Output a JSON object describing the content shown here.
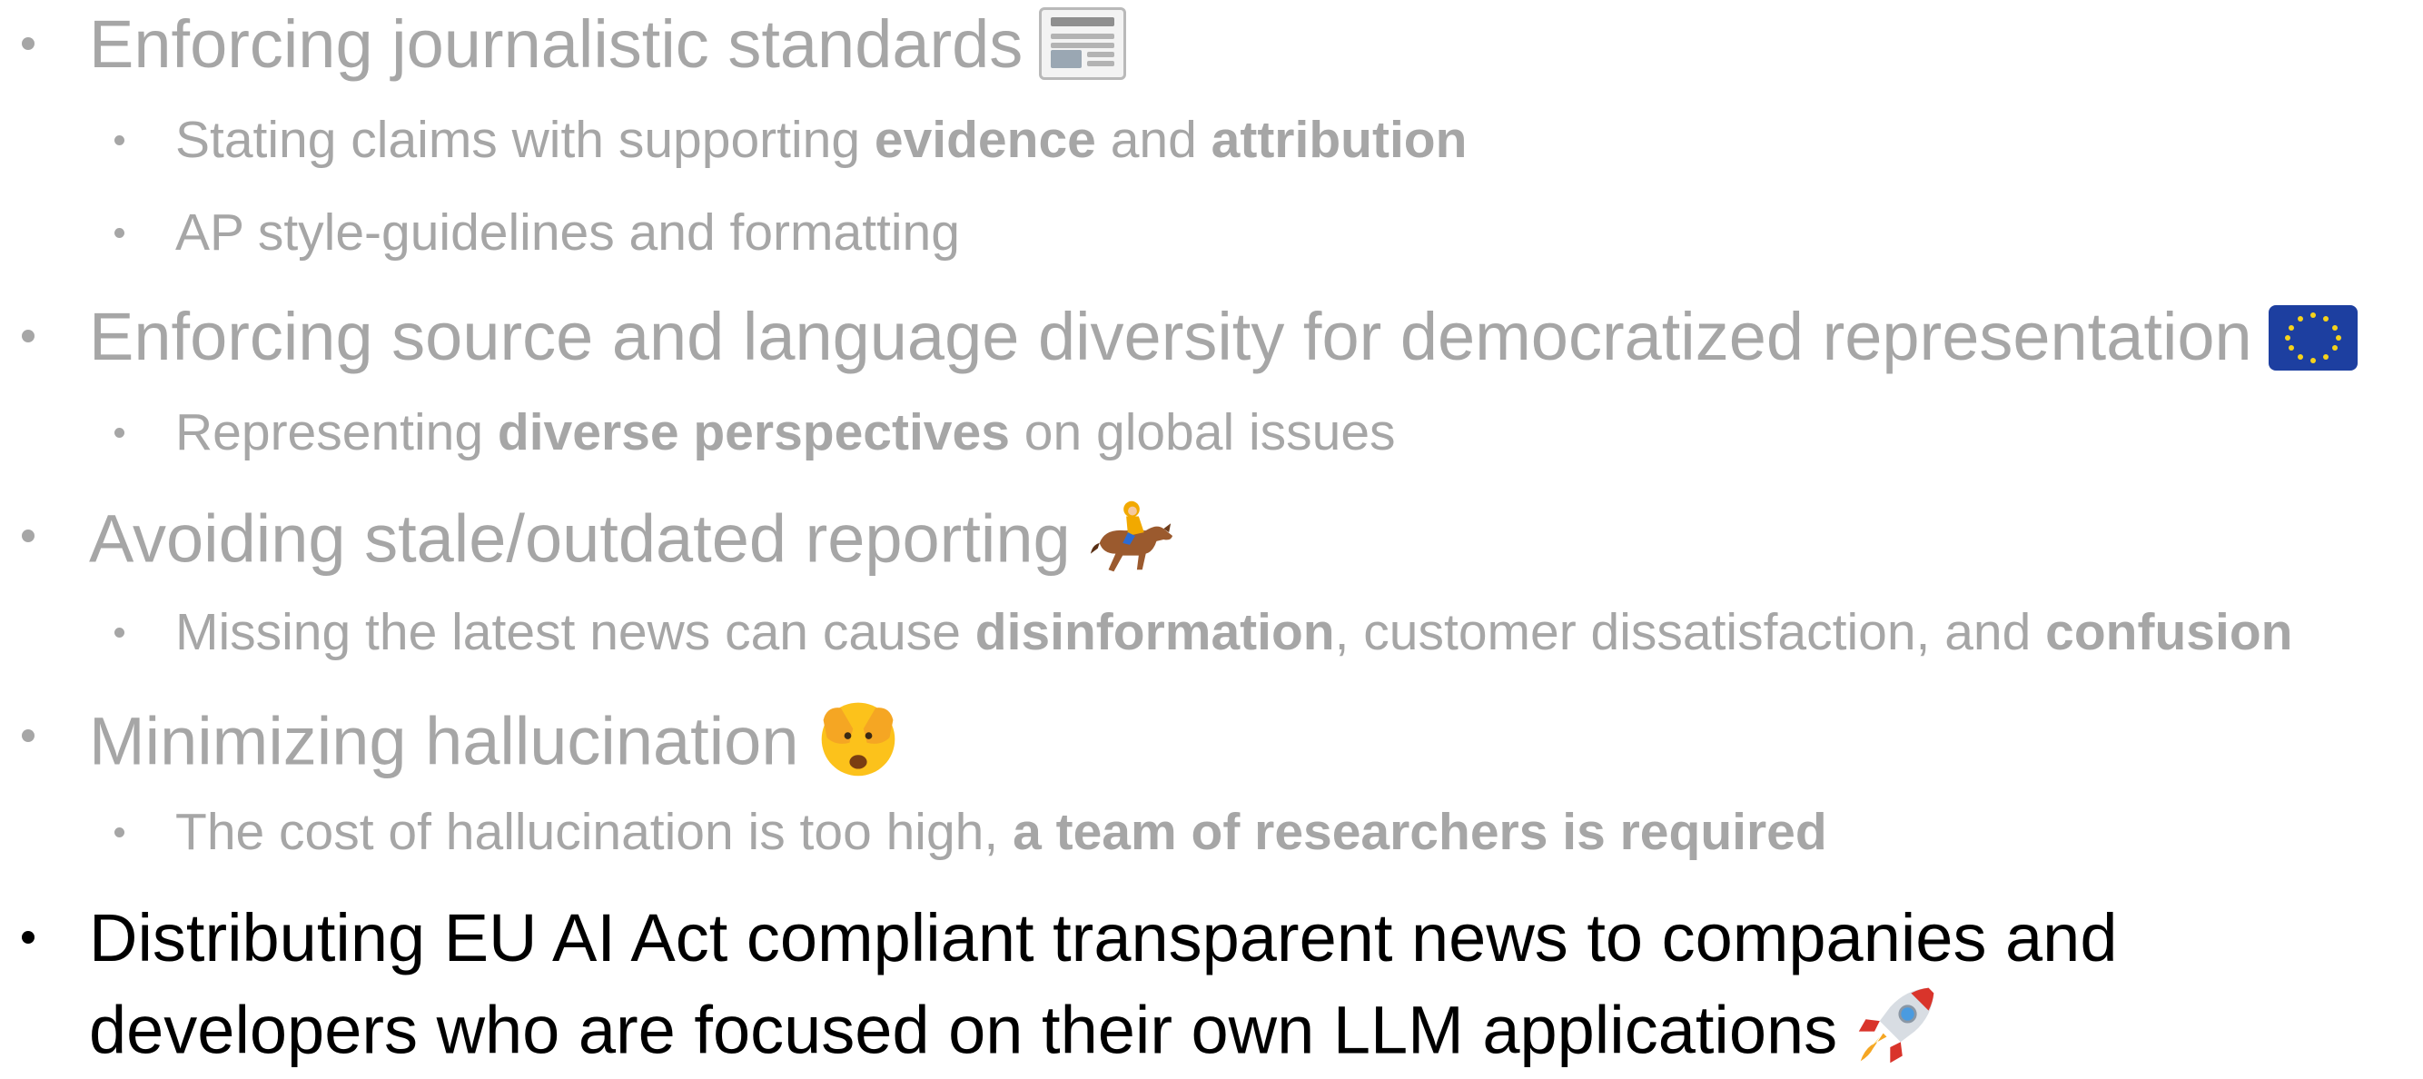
{
  "bullets": [
    {
      "level": 1,
      "style": "dim",
      "text": "Enforcing journalistic standards",
      "emoji": "newspaper-icon"
    },
    {
      "level": 2,
      "style": "dim",
      "parts": [
        {
          "t": "Stating claims with supporting ",
          "b": false
        },
        {
          "t": "evidence",
          "b": true
        },
        {
          "t": " and ",
          "b": false
        },
        {
          "t": "attribution",
          "b": true
        }
      ]
    },
    {
      "level": 2,
      "style": "dim",
      "parts": [
        {
          "t": "AP style-guidelines and formatting",
          "b": false
        }
      ]
    },
    {
      "level": 1,
      "style": "dim",
      "text": "Enforcing source and language diversity for democratized representation",
      "emoji": "eu-flag-icon"
    },
    {
      "level": 2,
      "style": "dim",
      "parts": [
        {
          "t": "Representing ",
          "b": false
        },
        {
          "t": "diverse perspectives",
          "b": true
        },
        {
          "t": " on global issues",
          "b": false
        }
      ]
    },
    {
      "level": 1,
      "style": "dim",
      "text": "Avoiding stale/outdated reporting",
      "emoji": "horse-racing-icon"
    },
    {
      "level": 2,
      "style": "dim",
      "parts": [
        {
          "t": "Missing the latest news can cause ",
          "b": false
        },
        {
          "t": "disinformation",
          "b": true
        },
        {
          "t": ", customer dissatisfaction, and ",
          "b": false
        },
        {
          "t": "confusion",
          "b": true
        }
      ]
    },
    {
      "level": 1,
      "style": "dim",
      "text": "Minimizing hallucination",
      "emoji": "face-with-peeking-eye-icon"
    },
    {
      "level": 2,
      "style": "dim",
      "parts": [
        {
          "t": "The cost of hallucination is too high, ",
          "b": false
        },
        {
          "t": "a team of researchers is required",
          "b": true
        }
      ]
    },
    {
      "level": 1,
      "style": "dark",
      "text": "Distributing EU AI Act compliant transparent news to companies and",
      "text2": "developers who are focused on their own LLM applications",
      "emoji": "rocket-icon"
    }
  ],
  "colors": {
    "dim": "#a6a6a6",
    "dark": "#000000",
    "background": "#ffffff"
  }
}
